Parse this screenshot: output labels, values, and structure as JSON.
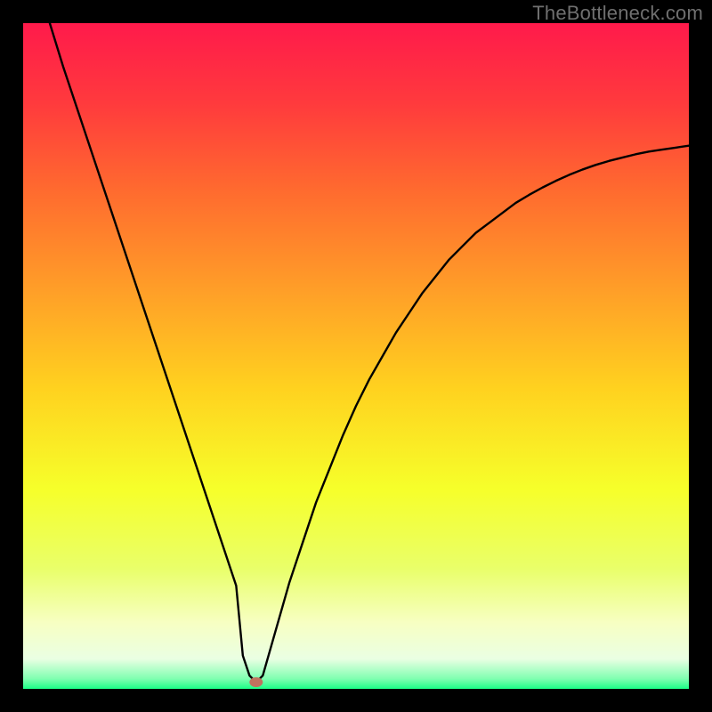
{
  "watermark": "TheBottleneck.com",
  "chart_data": {
    "type": "line",
    "title": "",
    "xlabel": "",
    "ylabel": "",
    "xlim": [
      0,
      100
    ],
    "ylim": [
      0,
      100
    ],
    "x": [
      4,
      6,
      8,
      10,
      12,
      14,
      16,
      18,
      20,
      22,
      24,
      26,
      28,
      30,
      32,
      33,
      34,
      35,
      36,
      38,
      40,
      42,
      44,
      46,
      48,
      50,
      52,
      54,
      56,
      58,
      60,
      62,
      64,
      66,
      68,
      70,
      72,
      74,
      76,
      78,
      80,
      82,
      84,
      86,
      88,
      90,
      92,
      94,
      96,
      98,
      100
    ],
    "y": [
      100,
      93.5,
      87.5,
      81.5,
      75.5,
      69.5,
      63.5,
      57.5,
      51.5,
      45.5,
      39.5,
      33.5,
      27.5,
      21.5,
      15.5,
      5,
      2,
      1,
      2,
      9,
      16,
      22,
      28,
      33,
      38,
      42.5,
      46.5,
      50,
      53.5,
      56.5,
      59.5,
      62,
      64.5,
      66.5,
      68.5,
      70,
      71.5,
      73,
      74.2,
      75.3,
      76.3,
      77.2,
      78,
      78.7,
      79.3,
      79.8,
      80.3,
      80.7,
      81,
      81.3,
      81.6
    ],
    "marker": {
      "x": 35,
      "y": 1
    },
    "gradient_stops": [
      {
        "offset": 0.0,
        "color": "#ff1a4b"
      },
      {
        "offset": 0.12,
        "color": "#ff3a3d"
      },
      {
        "offset": 0.25,
        "color": "#ff6a2f"
      },
      {
        "offset": 0.4,
        "color": "#ff9e28"
      },
      {
        "offset": 0.55,
        "color": "#ffd21f"
      },
      {
        "offset": 0.7,
        "color": "#f6ff2a"
      },
      {
        "offset": 0.82,
        "color": "#e9ff6a"
      },
      {
        "offset": 0.9,
        "color": "#f7ffc2"
      },
      {
        "offset": 0.955,
        "color": "#eaffe3"
      },
      {
        "offset": 0.985,
        "color": "#7fffb0"
      },
      {
        "offset": 1.0,
        "color": "#1bff86"
      }
    ]
  }
}
